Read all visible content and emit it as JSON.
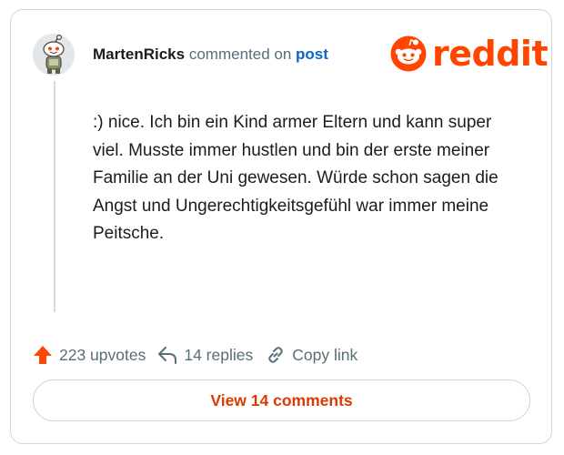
{
  "comment": {
    "author": "MartenRicks",
    "commented_on_text": " commented on ",
    "post_link": "post",
    "body": ":) nice. Ich bin ein Kind armer Eltern und kann super viel. Musste immer hustlen und bin der erste meiner Familie an der Uni gewesen. Würde schon sagen die Angst und Ungerechtigkeitsgefühl war immer meine Peitsche."
  },
  "brand": {
    "wordmark": "reddit",
    "color": "#ff4500"
  },
  "footer": {
    "upvotes": "223 upvotes",
    "replies": "14 replies",
    "copy_link": "Copy link",
    "upvote_color": "#ff4500"
  },
  "view_comments_label": "View 14 comments",
  "icons": [
    "snoo-avatar-icon",
    "reddit-logo-icon",
    "upvote-arrow-icon",
    "reply-arrow-icon",
    "link-icon"
  ]
}
